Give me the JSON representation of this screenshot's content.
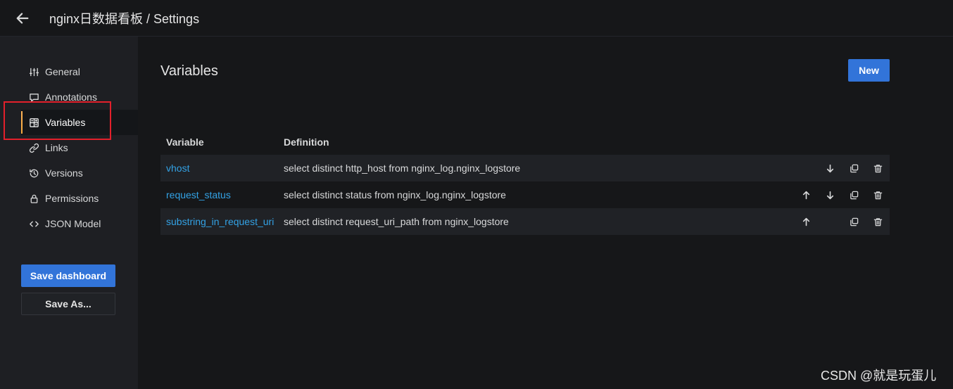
{
  "header": {
    "title": "nginx日数据看板 / Settings",
    "back_icon": "arrow-left-icon"
  },
  "sidebar": {
    "items": [
      {
        "label": "General",
        "icon": "sliders-icon",
        "active": false
      },
      {
        "label": "Annotations",
        "icon": "comment-icon",
        "active": false
      },
      {
        "label": "Variables",
        "icon": "calculator-icon",
        "active": true
      },
      {
        "label": "Links",
        "icon": "link-icon",
        "active": false
      },
      {
        "label": "Versions",
        "icon": "history-icon",
        "active": false
      },
      {
        "label": "Permissions",
        "icon": "lock-icon",
        "active": false
      },
      {
        "label": "JSON Model",
        "icon": "code-icon",
        "active": false
      }
    ],
    "save_label": "Save dashboard",
    "save_as_label": "Save As..."
  },
  "main": {
    "title": "Variables",
    "new_label": "New",
    "table": {
      "headers": [
        "Variable",
        "Definition"
      ],
      "rows": [
        {
          "name": "vhost",
          "definition": "select distinct http_host from nginx_log.nginx_logstore",
          "up": false,
          "down": true
        },
        {
          "name": "request_status",
          "definition": "select distinct status from nginx_log.nginx_logstore",
          "up": true,
          "down": true
        },
        {
          "name": "substring_in_request_uri",
          "definition": "select distinct request_uri_path from nginx_logstore",
          "up": true,
          "down": false
        }
      ]
    }
  },
  "colors": {
    "accent": "#3274d9",
    "link": "#33a2e5",
    "active_marker": "#f6aa3c",
    "highlight_box": "#e3202b"
  },
  "watermark": "CSDN @就是玩蛋儿"
}
